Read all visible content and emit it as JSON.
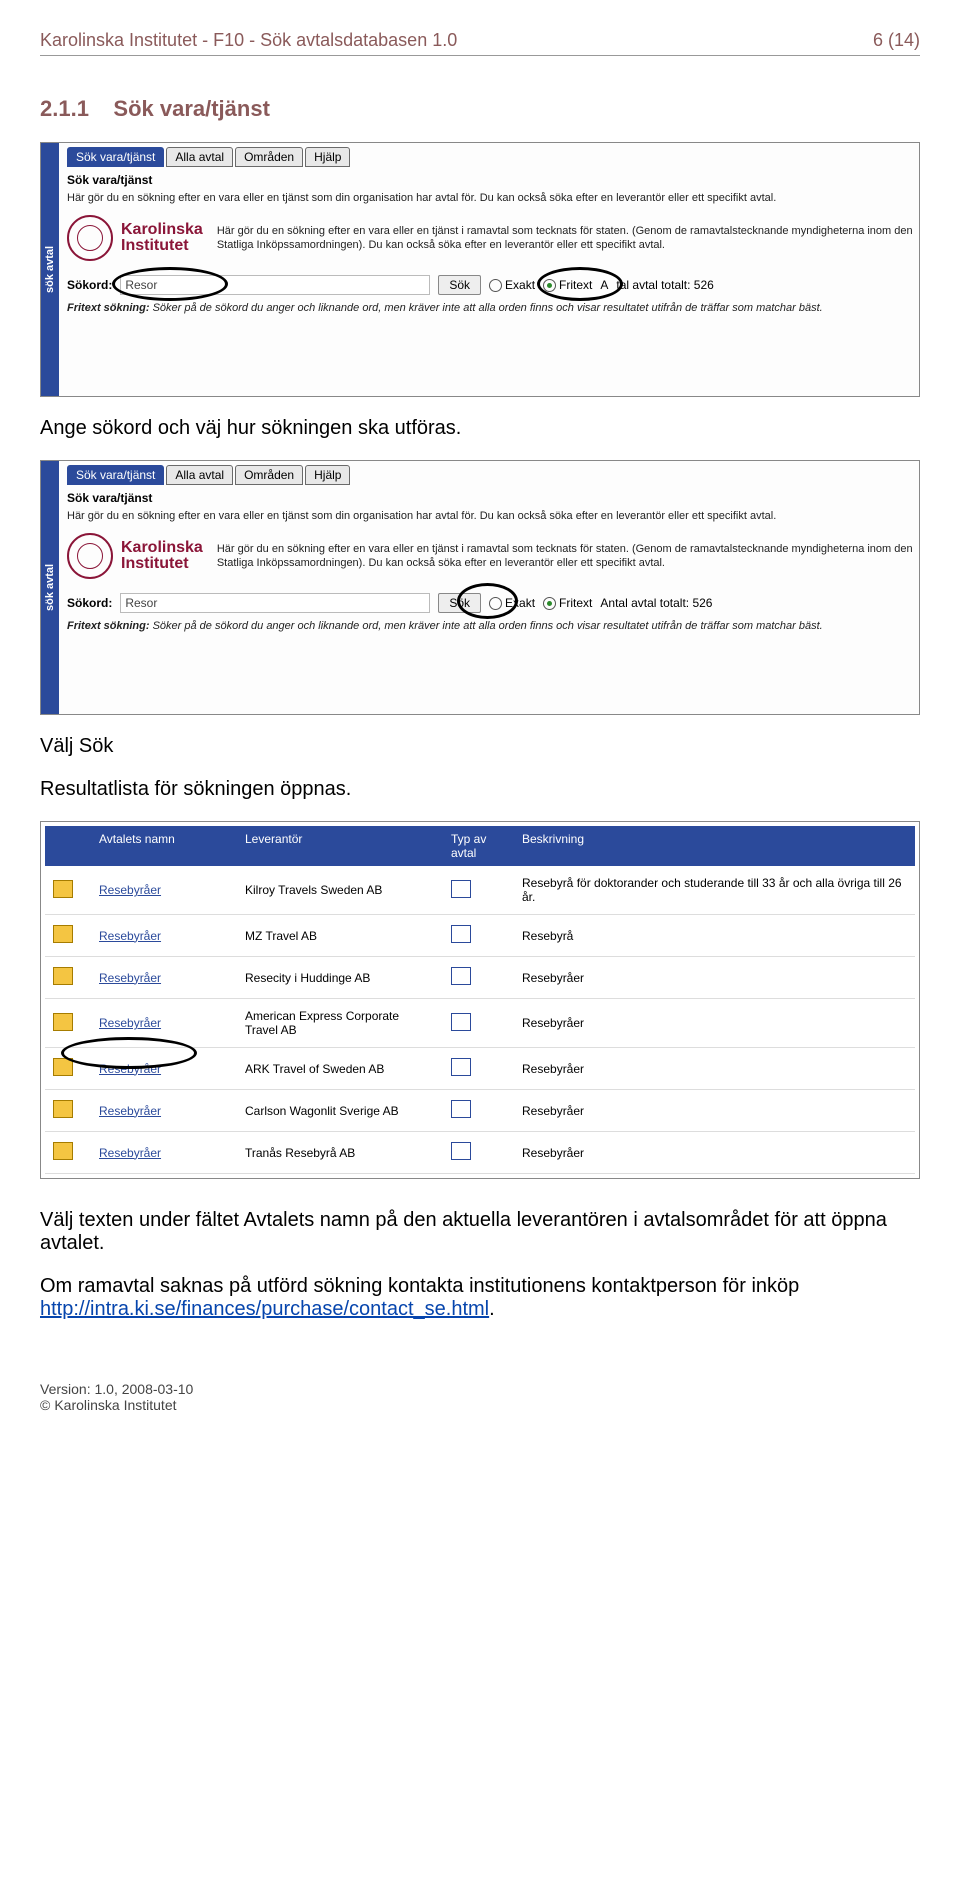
{
  "header": {
    "title": "Karolinska Institutet - F10 - Sök avtalsdatabasen 1.0",
    "pageno": "6 (14)"
  },
  "section": {
    "number": "2.1.1",
    "title": "Sök vara/tjänst"
  },
  "screenshot_common": {
    "side_tab": "sök avtal",
    "tabs": [
      "Sök vara/tjänst",
      "Alla avtal",
      "Områden",
      "Hjälp"
    ],
    "panel_title": "Sök vara/tjänst",
    "panel_intro": "Här gör du en sökning efter en vara eller en tjänst som din organisation har avtal för. Du kan också söka efter en leverantör eller ett specifikt avtal.",
    "logo_name1": "Karolinska",
    "logo_name2": "Institutet",
    "logo_desc": "Här gör du en sökning efter en vara eller en tjänst i ramavtal som tecknats för staten. (Genom de ramavtalstecknande myndigheterna inom den Statliga Inköpssamordningen). Du kan också söka efter en leverantör eller ett specifikt avtal.",
    "sokord_label": "Sökord:",
    "sokord_value": "Resor",
    "sok_btn": "Sök",
    "radio_exakt": "Exakt",
    "radio_fritext": "Fritext",
    "total_label": "Antal avtal totalt: 526",
    "total_label_trunc": "tal avtal totalt: 526",
    "fritext_bold": "Fritext sökning:",
    "fritext_help": "Söker på de sökord du anger och liknande ord, men kräver inte att alla orden finns och visar resultatet utifrån de träffar som matchar bäst."
  },
  "para1": "Ange sökord och väj hur sökningen ska utföras.",
  "para2a": "Välj Sök",
  "para2b": "Resultatlista för sökningen öppnas.",
  "results": {
    "headers": {
      "name": "Avtalets namn",
      "lev": "Leverantör",
      "type": "Typ av avtal",
      "desc": "Beskrivning"
    },
    "rows": [
      {
        "name": "Resebyråer",
        "lev": "Kilroy Travels Sweden AB",
        "desc": "Resebyrå för doktorander och studerande till 33 år och alla övriga till 26 år."
      },
      {
        "name": "Resebyråer",
        "lev": "MZ Travel AB",
        "desc": "Resebyrå"
      },
      {
        "name": "Resebyråer",
        "lev": "Resecity i Huddinge AB",
        "desc": "Resebyråer"
      },
      {
        "name": "Resebyråer",
        "lev": "American Express Corporate Travel AB",
        "desc": "Resebyråer"
      },
      {
        "name": "Resebyråer",
        "lev": "ARK Travel of Sweden AB",
        "desc": "Resebyråer"
      },
      {
        "name": "Resebyråer",
        "lev": "Carlson Wagonlit Sverige AB",
        "desc": "Resebyråer"
      },
      {
        "name": "Resebyråer",
        "lev": "Tranås Resebyrå AB",
        "desc": "Resebyråer"
      }
    ]
  },
  "para3": "Välj texten under fältet Avtalets namn på den aktuella leverantören i avtalsområdet för att öppna avtalet.",
  "para4a": "Om ramavtal saknas på utförd sökning kontakta institutionens kontaktperson för inköp ",
  "para4_link": "http://intra.ki.se/finances/purchase/contact_se.html",
  "para4b": ".",
  "footer": {
    "version": "Version: 1.0, 2008-03-10",
    "copyright": "Karolinska Institutet"
  }
}
